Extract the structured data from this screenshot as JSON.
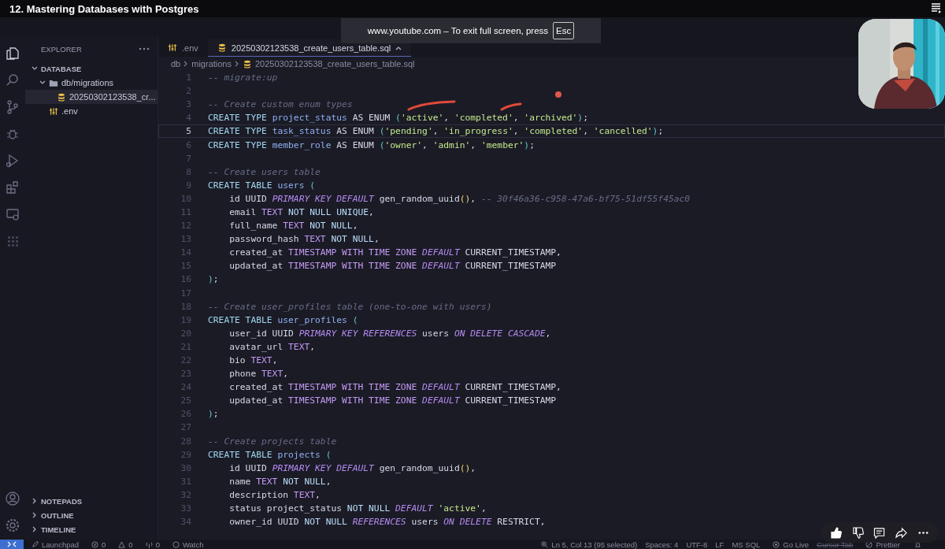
{
  "video_title": "12. Mastering Databases with Postgres",
  "fullscreen_toast": {
    "message": "www.youtube.com – To exit full screen, press",
    "key": "Esc"
  },
  "sidebar": {
    "title": "EXPLORER",
    "section": {
      "label": "DATABASE",
      "expanded": true,
      "children": [
        {
          "label": "db/migrations",
          "kind": "folder",
          "expanded": true,
          "selected": false,
          "children": [
            {
              "label": "20250302123538_cr...",
              "kind": "sql",
              "selected": true
            }
          ]
        },
        {
          "label": ".env",
          "kind": "env",
          "selected": false
        }
      ]
    },
    "panels": [
      {
        "label": "NOTEPADS",
        "expanded": false
      },
      {
        "label": "OUTLINE",
        "expanded": false
      },
      {
        "label": "TIMELINE",
        "expanded": false
      }
    ]
  },
  "tabs": [
    {
      "label": ".env",
      "kind": "env",
      "selected": false
    },
    {
      "label": "20250302123538_create_users_table.sql",
      "kind": "sql",
      "selected": true
    }
  ],
  "breadcrumb": [
    "db",
    "migrations",
    "20250302123538_create_users_table.sql"
  ],
  "editor": {
    "lines": [
      {
        "n": "1",
        "current": false,
        "tokens": [
          {
            "kind": "c",
            "text": "-- migrate:up"
          }
        ]
      },
      {
        "n": "2",
        "current": false
      },
      {
        "n": "3",
        "current": false,
        "tokens": [
          {
            "kind": "c",
            "text": "-- Create custom enum types"
          }
        ]
      },
      {
        "n": "4",
        "current": false,
        "tokens": [
          {
            "kind": "k",
            "text": "CREATE TYPE "
          },
          {
            "kind": "n",
            "text": "project_status"
          },
          {
            "kind": "p",
            "text": " AS ENUM "
          },
          {
            "kind": "b",
            "text": "("
          },
          {
            "kind": "s",
            "text": "'active'"
          },
          {
            "kind": "p",
            "text": ", "
          },
          {
            "kind": "s",
            "text": "'completed'"
          },
          {
            "kind": "p",
            "text": ", "
          },
          {
            "kind": "s",
            "text": "'archived'"
          },
          {
            "kind": "b",
            "text": ")"
          },
          {
            "kind": "p",
            "text": ";"
          }
        ]
      },
      {
        "n": "5",
        "current": true,
        "tokens": [
          {
            "kind": "k",
            "text": "CREATE TYPE "
          },
          {
            "kind": "n",
            "text": "task_status"
          },
          {
            "kind": "p",
            "text": " AS ENUM "
          },
          {
            "kind": "b",
            "text": "("
          },
          {
            "kind": "s",
            "text": "'pending'"
          },
          {
            "kind": "p",
            "text": ", "
          },
          {
            "kind": "s",
            "text": "'in_progress'"
          },
          {
            "kind": "p",
            "text": ", "
          },
          {
            "kind": "s",
            "text": "'completed'"
          },
          {
            "kind": "p",
            "text": ", "
          },
          {
            "kind": "s",
            "text": "'cancelled'"
          },
          {
            "kind": "b",
            "text": ")"
          },
          {
            "kind": "p",
            "text": ";"
          }
        ]
      },
      {
        "n": "6",
        "current": false,
        "tokens": [
          {
            "kind": "k",
            "text": "CREATE TYPE "
          },
          {
            "kind": "n",
            "text": "member_role"
          },
          {
            "kind": "p",
            "text": " AS ENUM "
          },
          {
            "kind": "b",
            "text": "("
          },
          {
            "kind": "s",
            "text": "'owner'"
          },
          {
            "kind": "p",
            "text": ", "
          },
          {
            "kind": "s",
            "text": "'admin'"
          },
          {
            "kind": "p",
            "text": ", "
          },
          {
            "kind": "s",
            "text": "'member'"
          },
          {
            "kind": "b",
            "text": ")"
          },
          {
            "kind": "p",
            "text": ";"
          }
        ]
      },
      {
        "n": "7",
        "current": false
      },
      {
        "n": "8",
        "current": false,
        "tokens": [
          {
            "kind": "c",
            "text": "-- Create users table"
          }
        ]
      },
      {
        "n": "9",
        "current": false,
        "tokens": [
          {
            "kind": "k",
            "text": "CREATE TABLE "
          },
          {
            "kind": "n",
            "text": "users "
          },
          {
            "kind": "b",
            "text": "("
          }
        ]
      },
      {
        "n": "10",
        "current": false,
        "tokens": [
          {
            "kind": "p",
            "text": "    id UUID "
          },
          {
            "kind": "i",
            "text": "PRIMARY KEY DEFAULT"
          },
          {
            "kind": "p",
            "text": " gen_random_uuid"
          },
          {
            "kind": "y",
            "text": "()"
          },
          {
            "kind": "p",
            "text": ", "
          },
          {
            "kind": "c",
            "text": "-- 30f46a36-c958-47a6-bf75-51df55f45ac0"
          }
        ]
      },
      {
        "n": "11",
        "current": false,
        "tokens": [
          {
            "kind": "p",
            "text": "    email "
          },
          {
            "kind": "t",
            "text": "TEXT"
          },
          {
            "kind": "u",
            "text": " NOT NULL UNIQUE"
          },
          {
            "kind": "p",
            "text": ","
          }
        ]
      },
      {
        "n": "12",
        "current": false,
        "tokens": [
          {
            "kind": "p",
            "text": "    full_name "
          },
          {
            "kind": "t",
            "text": "TEXT"
          },
          {
            "kind": "u",
            "text": " NOT NULL"
          },
          {
            "kind": "p",
            "text": ","
          }
        ]
      },
      {
        "n": "13",
        "current": false,
        "tokens": [
          {
            "kind": "p",
            "text": "    password_hash "
          },
          {
            "kind": "t",
            "text": "TEXT"
          },
          {
            "kind": "u",
            "text": " NOT NULL"
          },
          {
            "kind": "p",
            "text": ","
          }
        ]
      },
      {
        "n": "14",
        "current": false,
        "tokens": [
          {
            "kind": "p",
            "text": "    created_at "
          },
          {
            "kind": "t",
            "text": "TIMESTAMP WITH TIME ZONE "
          },
          {
            "kind": "i",
            "text": "DEFAULT"
          },
          {
            "kind": "p",
            "text": " CURRENT_TIMESTAMP,"
          }
        ]
      },
      {
        "n": "15",
        "current": false,
        "tokens": [
          {
            "kind": "p",
            "text": "    updated_at "
          },
          {
            "kind": "t",
            "text": "TIMESTAMP WITH TIME ZONE "
          },
          {
            "kind": "i",
            "text": "DEFAULT"
          },
          {
            "kind": "p",
            "text": " CURRENT_TIMESTAMP"
          }
        ]
      },
      {
        "n": "16",
        "current": false,
        "tokens": [
          {
            "kind": "b",
            "text": ")"
          },
          {
            "kind": "p",
            "text": ";"
          }
        ]
      },
      {
        "n": "17",
        "current": false
      },
      {
        "n": "18",
        "current": false,
        "tokens": [
          {
            "kind": "c",
            "text": "-- Create user_profiles table (one-to-one with users)"
          }
        ]
      },
      {
        "n": "19",
        "current": false,
        "tokens": [
          {
            "kind": "k",
            "text": "CREATE TABLE "
          },
          {
            "kind": "n",
            "text": "user_profiles "
          },
          {
            "kind": "b",
            "text": "("
          }
        ]
      },
      {
        "n": "20",
        "current": false,
        "tokens": [
          {
            "kind": "p",
            "text": "    user_id UUID "
          },
          {
            "kind": "i",
            "text": "PRIMARY KEY REFERENCES"
          },
          {
            "kind": "p",
            "text": " users "
          },
          {
            "kind": "i",
            "text": "ON DELETE CASCADE"
          },
          {
            "kind": "p",
            "text": ","
          }
        ]
      },
      {
        "n": "21",
        "current": false,
        "tokens": [
          {
            "kind": "p",
            "text": "    avatar_url "
          },
          {
            "kind": "t",
            "text": "TEXT"
          },
          {
            "kind": "p",
            "text": ","
          }
        ]
      },
      {
        "n": "22",
        "current": false,
        "tokens": [
          {
            "kind": "p",
            "text": "    bio "
          },
          {
            "kind": "t",
            "text": "TEXT"
          },
          {
            "kind": "p",
            "text": ","
          }
        ]
      },
      {
        "n": "23",
        "current": false,
        "tokens": [
          {
            "kind": "p",
            "text": "    phone "
          },
          {
            "kind": "t",
            "text": "TEXT"
          },
          {
            "kind": "p",
            "text": ","
          }
        ]
      },
      {
        "n": "24",
        "current": false,
        "tokens": [
          {
            "kind": "p",
            "text": "    created_at "
          },
          {
            "kind": "t",
            "text": "TIMESTAMP WITH TIME ZONE "
          },
          {
            "kind": "i",
            "text": "DEFAULT"
          },
          {
            "kind": "p",
            "text": " CURRENT_TIMESTAMP,"
          }
        ]
      },
      {
        "n": "25",
        "current": false,
        "tokens": [
          {
            "kind": "p",
            "text": "    updated_at "
          },
          {
            "kind": "t",
            "text": "TIMESTAMP WITH TIME ZONE "
          },
          {
            "kind": "i",
            "text": "DEFAULT"
          },
          {
            "kind": "p",
            "text": " CURRENT_TIMESTAMP"
          }
        ]
      },
      {
        "n": "26",
        "current": false,
        "tokens": [
          {
            "kind": "b",
            "text": ")"
          },
          {
            "kind": "p",
            "text": ";"
          }
        ]
      },
      {
        "n": "27",
        "current": false
      },
      {
        "n": "28",
        "current": false,
        "tokens": [
          {
            "kind": "c",
            "text": "-- Create projects table"
          }
        ]
      },
      {
        "n": "29",
        "current": false,
        "tokens": [
          {
            "kind": "k",
            "text": "CREATE TABLE "
          },
          {
            "kind": "n",
            "text": "projects "
          },
          {
            "kind": "b",
            "text": "("
          }
        ]
      },
      {
        "n": "30",
        "current": false,
        "tokens": [
          {
            "kind": "p",
            "text": "    id UUID "
          },
          {
            "kind": "i",
            "text": "PRIMARY KEY DEFAULT"
          },
          {
            "kind": "p",
            "text": " gen_random_uuid"
          },
          {
            "kind": "y",
            "text": "()"
          },
          {
            "kind": "p",
            "text": ","
          }
        ]
      },
      {
        "n": "31",
        "current": false,
        "tokens": [
          {
            "kind": "p",
            "text": "    name "
          },
          {
            "kind": "t",
            "text": "TEXT"
          },
          {
            "kind": "u",
            "text": " NOT NULL"
          },
          {
            "kind": "p",
            "text": ","
          }
        ]
      },
      {
        "n": "32",
        "current": false,
        "tokens": [
          {
            "kind": "p",
            "text": "    description "
          },
          {
            "kind": "t",
            "text": "TEXT"
          },
          {
            "kind": "p",
            "text": ","
          }
        ]
      },
      {
        "n": "33",
        "current": false,
        "tokens": [
          {
            "kind": "p",
            "text": "    status project_status "
          },
          {
            "kind": "u",
            "text": "NOT NULL "
          },
          {
            "kind": "i",
            "text": "DEFAULT "
          },
          {
            "kind": "s",
            "text": "'active'"
          },
          {
            "kind": "p",
            "text": ","
          }
        ]
      },
      {
        "n": "34",
        "current": false,
        "tokens": [
          {
            "kind": "p",
            "text": "    owner_id UUID "
          },
          {
            "kind": "u",
            "text": "NOT NULL "
          },
          {
            "kind": "i",
            "text": "REFERENCES"
          },
          {
            "kind": "p",
            "text": " users "
          },
          {
            "kind": "i",
            "text": "ON DELETE"
          },
          {
            "kind": "p",
            "text": " RESTRICT,"
          }
        ]
      }
    ]
  },
  "status_bar": {
    "launchpad": "Launchpad",
    "errors": "0",
    "warnings": "0",
    "ports": "0",
    "watch": "Watch",
    "right": [
      {
        "label": "Ln 5, Col 13 (95 selected)",
        "disabled": false
      },
      {
        "label": "Spaces: 4",
        "disabled": false
      },
      {
        "label": "UTF-8",
        "disabled": false
      },
      {
        "label": "LF",
        "disabled": false
      },
      {
        "label": "MS SQL",
        "disabled": false
      },
      {
        "label": "Go Live",
        "disabled": false
      },
      {
        "label": "Cursor Tab",
        "disabled": true
      },
      {
        "label": "Prettier",
        "disabled": false
      }
    ]
  },
  "video_actions": {
    "liked": true
  }
}
